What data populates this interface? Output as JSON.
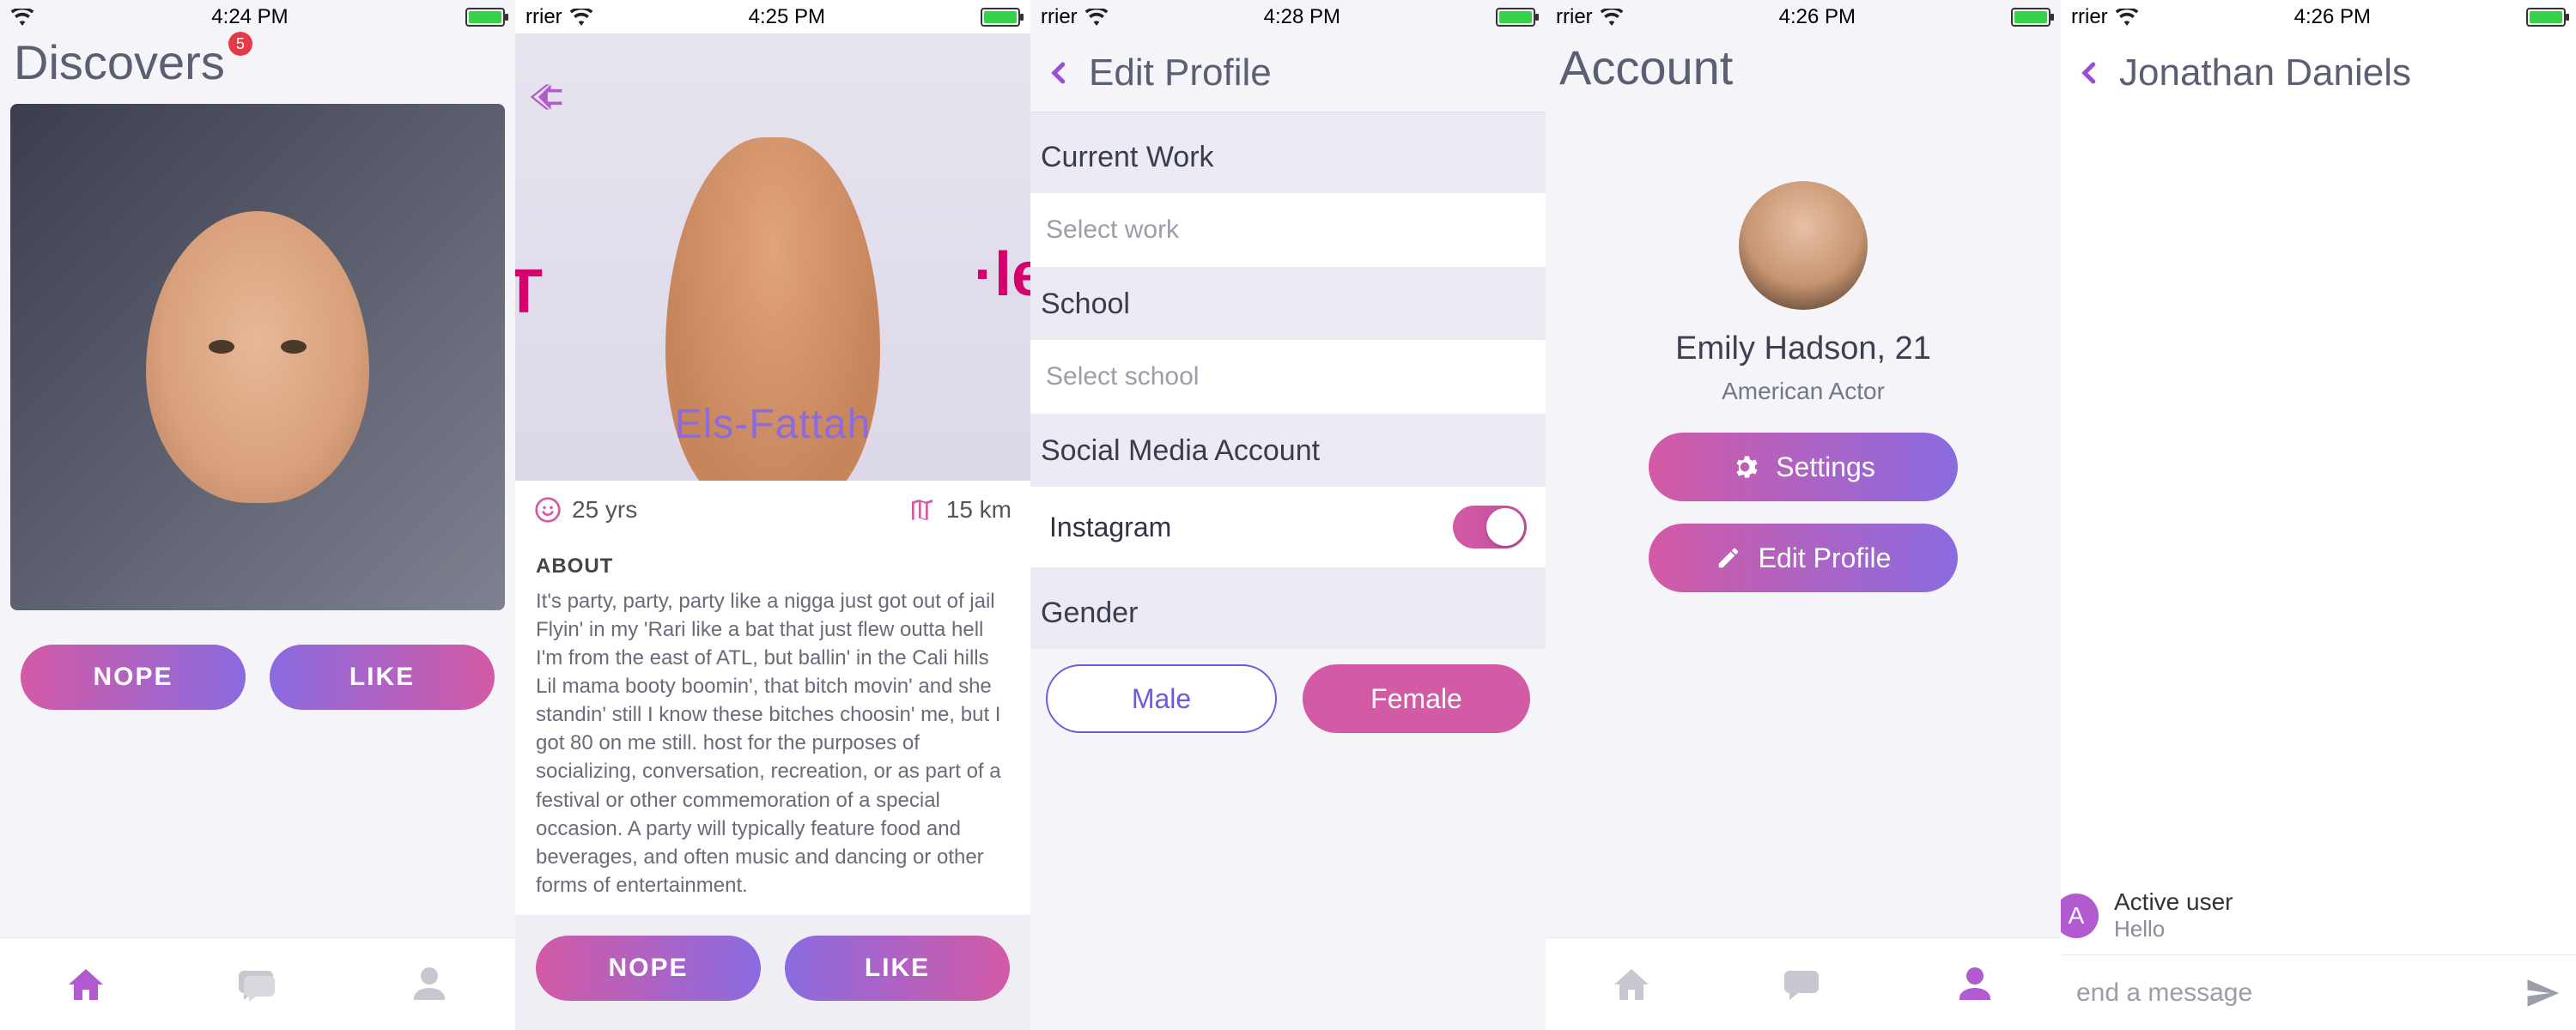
{
  "status": {
    "carrier_trunc": "rrier",
    "time1": "4:24 PM",
    "time2": "4:25 PM",
    "time3": "4:28 PM",
    "time4": "4:26 PM",
    "time5": "4:26 PM"
  },
  "discover": {
    "title": "Discovers",
    "badge": "5",
    "nope": "NOPE",
    "like": "LIKE"
  },
  "detail": {
    "name": "Els-Fattah",
    "age": "25 yrs",
    "distance": "15 km",
    "about_heading": "ABOUT",
    "about_body": "It's party, party, party like a nigga just got out of jail Flyin' in my 'Rari like a bat that just flew outta hell I'm from the east of ATL, but ballin' in the Cali hills Lil mama booty boomin', that bitch movin' and she standin' still I know these bitches choosin' me, but I got 80 on me still. host for the purposes of socializing, conversation, recreation, or as part of a festival or other commemoration of a special occasion. A party will typically feature food and beverages, and often music and dancing or other forms of entertainment.",
    "nope": "NOPE",
    "like": "LIKE"
  },
  "edit": {
    "title": "Edit Profile",
    "sections": {
      "work": "Current Work",
      "work_ph": "Select work",
      "school": "School",
      "school_ph": "Select school",
      "social": "Social Media Account",
      "instagram": "Instagram",
      "gender": "Gender",
      "male": "Male",
      "female": "Female"
    }
  },
  "account": {
    "title": "Account",
    "name": "Emily Hadson, 21",
    "subtitle": "American Actor",
    "settings": "Settings",
    "edit_profile": "Edit Profile"
  },
  "chat": {
    "title": "Jonathan Daniels",
    "incoming_name": "Active user",
    "incoming_msg": "Hello",
    "avatar_letter": "A",
    "placeholder": "end a message"
  }
}
